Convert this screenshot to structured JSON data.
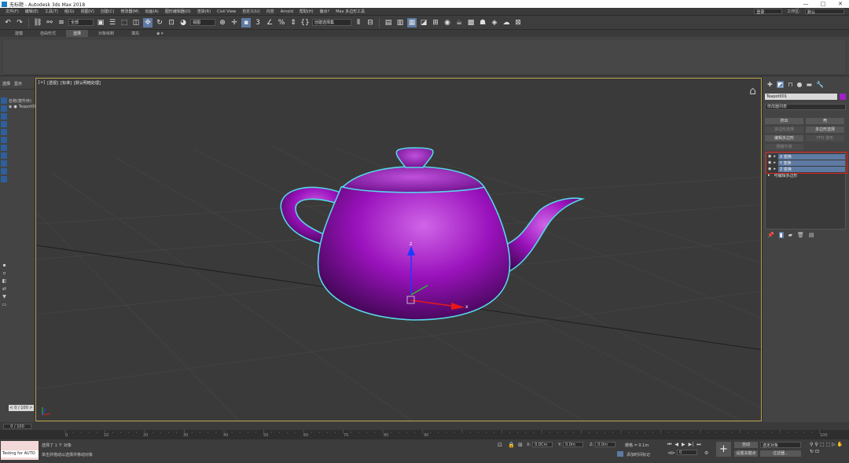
{
  "window": {
    "title": "无标题 - Autodesk 3ds Max 2018",
    "minimize": "—",
    "maximize": "□",
    "close": "✕"
  },
  "menu": {
    "items": [
      "文件(F)",
      "编辑(E)",
      "工具(T)",
      "组(G)",
      "视图(V)",
      "创建(C)",
      "修改器(M)",
      "动画(A)",
      "图形编辑器(D)",
      "渲染(R)",
      "Civil View",
      "自定义(U)",
      "内容",
      "Arnold",
      "帮助(H)",
      "偏点?",
      "Max 多边形工具"
    ],
    "workspace_label": "工作区:",
    "workspace_value": "默认",
    "account_value": "登录"
  },
  "toolbar": {
    "undo": "↶",
    "redo": "↷",
    "filter_value": "全部",
    "ref_coord_value": "视图",
    "selection_set_value": "创建选择集"
  },
  "ribbon": {
    "tabs": [
      "建模",
      "自由形式",
      "选择",
      "对象绘制",
      "填充"
    ],
    "active_tab": 2,
    "extra": "◉ ▾"
  },
  "scene_explorer": {
    "tabs": [
      "选择",
      "显示"
    ],
    "header": "名称(按升序)",
    "rows": [
      "Teapot001"
    ],
    "frame_label": "< 0 / 100 >"
  },
  "viewport": {
    "labels": [
      "[+]",
      "[透视]",
      "[标准]",
      "[默认明暗处理]"
    ],
    "gizmo_z": "z",
    "gizmo_x": "x",
    "selection_color": "#55d7e6",
    "teapot_color": "#a020c8"
  },
  "command_panel": {
    "object_name": "Teapot001",
    "object_color": "#a020c8",
    "modifier_list": "修改器列表",
    "buttons": [
      {
        "label": "挤出",
        "dim": false
      },
      {
        "label": "壳",
        "dim": false
      },
      {
        "label": "多边形选择",
        "dim": true
      },
      {
        "label": "多边形选择",
        "dim": false
      },
      {
        "label": "编辑多边形",
        "dim": false
      },
      {
        "label": "FFD 变形",
        "dim": true
      },
      {
        "label": "网格平滑",
        "dim": true
      }
    ],
    "stack": [
      {
        "label": "X 变换",
        "selected": true
      },
      {
        "label": "Y 变换",
        "selected": true
      },
      {
        "label": "Z 变换",
        "selected": true
      },
      {
        "label": "可编辑多边形",
        "selected": false
      }
    ]
  },
  "timeslider": {
    "frame": "0 / 100"
  },
  "track": {
    "ticks": [
      "0",
      "10",
      "20",
      "30",
      "40",
      "50",
      "60",
      "70",
      "80",
      "90",
      "100"
    ]
  },
  "status": {
    "script_listener": "Testing for AUTO",
    "line1": "选择了 1 个 对象",
    "line2": "单击并拖动以选择并移动对象",
    "x_label": "X:",
    "x_value": "0.0Cm",
    "y_label": "Y:",
    "y_value": "0.0m",
    "z_label": "Z:",
    "z_value": "0.0m",
    "grid": "栅格 = 0.1m",
    "add_time_tag": "添加时间标记",
    "auto_key": "自动",
    "set_key": "设置关键点",
    "selected_object": "选定对象",
    "key_filters": "过滤器...",
    "frame_input": "0"
  }
}
